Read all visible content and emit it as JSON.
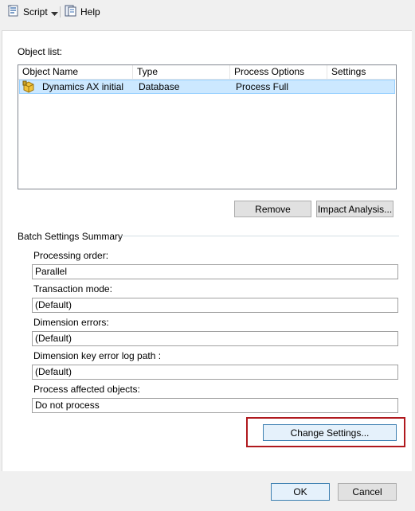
{
  "toolbar": {
    "script_label": "Script",
    "help_label": "Help"
  },
  "object_list": {
    "label": "Object list:",
    "columns": [
      "Object Name",
      "Type",
      "Process Options",
      "Settings"
    ],
    "rows": [
      {
        "name": "Dynamics AX initial",
        "type": "Database",
        "process_options": "Process Full",
        "settings": ""
      }
    ]
  },
  "buttons": {
    "remove": "Remove",
    "impact_analysis": "Impact Analysis...",
    "change_settings": "Change Settings...",
    "ok": "OK",
    "cancel": "Cancel"
  },
  "batch_settings": {
    "title": "Batch Settings Summary",
    "fields": [
      {
        "label": "Processing order:",
        "value": "Parallel"
      },
      {
        "label": "Transaction mode:",
        "value": "(Default)"
      },
      {
        "label": "Dimension errors:",
        "value": "(Default)"
      },
      {
        "label": "Dimension key error log path :",
        "value": "(Default)"
      },
      {
        "label": "Process affected objects:",
        "value": "Do not process"
      }
    ]
  },
  "colors": {
    "selected_row": "#cce8ff",
    "highlight_border": "#b0191e",
    "focused_button": "#e5f1fb"
  }
}
